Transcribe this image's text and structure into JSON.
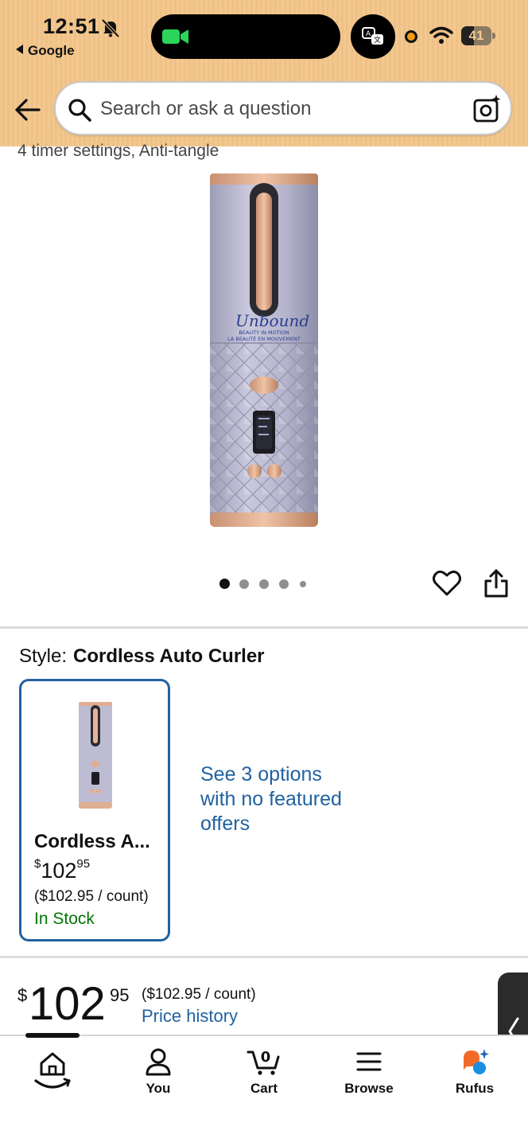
{
  "status_bar": {
    "time": "12:51",
    "back_app": "Google",
    "battery": "41"
  },
  "search": {
    "placeholder": "Search or ask a question"
  },
  "product": {
    "feature_snippet": "4 timer settings, Anti-tangle",
    "image_brand": "Unbound",
    "image_tagline_en": "BEAUTY IN MOTION",
    "image_tagline_fr": "LA BEAUTÉ EN MOUVEMENT",
    "image_count": 5,
    "active_image_index": 0
  },
  "style": {
    "label": "Style:",
    "value": "Cordless Auto Curler",
    "card": {
      "name": "Cordless A...",
      "price_symbol": "$",
      "price_whole": "102",
      "price_fraction": "95",
      "unit_price": "($102.95 / count)",
      "stock": "In Stock"
    },
    "see_options": "See 3 options with no featured offers"
  },
  "price": {
    "symbol": "$",
    "whole": "102",
    "fraction": "95",
    "unit_price": "($102.95 / count)",
    "history_link": "Price history"
  },
  "bottom_nav": {
    "items": [
      {
        "label": "",
        "icon": "home-icon"
      },
      {
        "label": "You",
        "icon": "user-icon"
      },
      {
        "label": "Cart",
        "icon": "cart-icon",
        "count": "0"
      },
      {
        "label": "Browse",
        "icon": "menu-icon"
      },
      {
        "label": "Rufus",
        "icon": "rufus-icon"
      }
    ]
  },
  "colors": {
    "header_bg": "#f3c88f",
    "link_blue": "#2162a1",
    "in_stock_green": "#007600",
    "selected_border": "#2162a1"
  }
}
